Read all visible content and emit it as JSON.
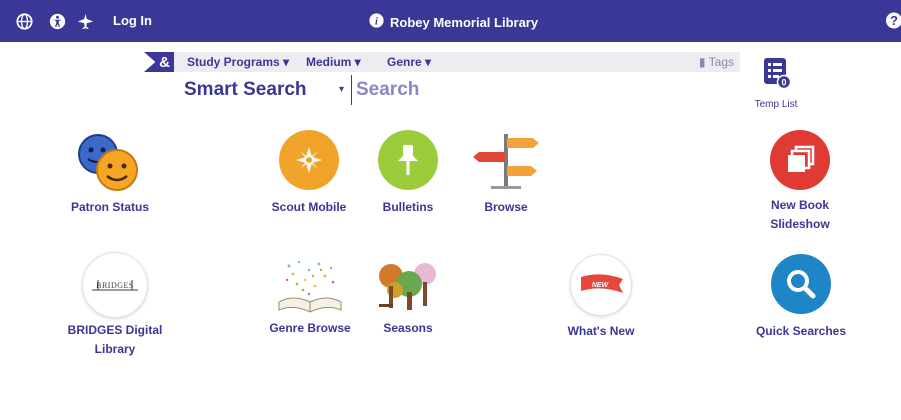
{
  "topbar": {
    "login_label": "Log In",
    "library_name": "Robey Memorial Library",
    "icons": [
      "globe-icon",
      "accessibility-icon",
      "plane-icon",
      "info-icon",
      "help-icon"
    ]
  },
  "search": {
    "amp_label": "&",
    "menus": [
      "Study Programs",
      "Medium",
      "Genre"
    ],
    "tags_label": "Tags",
    "mode_label": "Smart Search",
    "placeholder": "Search"
  },
  "temp_list": {
    "label": "Temp List",
    "count": "0"
  },
  "tiles": {
    "patron_status": "Patron Status",
    "scout_mobile": "Scout Mobile",
    "bulletins": "Bulletins",
    "browse": "Browse",
    "new_book_slideshow": [
      "New Book",
      "Slideshow"
    ],
    "bridges": [
      "BRIDGES Digital",
      "Library"
    ],
    "bridges_logo": "BRIDGES",
    "genre_browse": "Genre Browse",
    "seasons": "Seasons",
    "whats_new": "What's New",
    "whats_new_badge": "NEW",
    "quick_searches": "Quick Searches"
  },
  "colors": {
    "brand": "#3b3796",
    "filter_bg": "#ececf1"
  }
}
